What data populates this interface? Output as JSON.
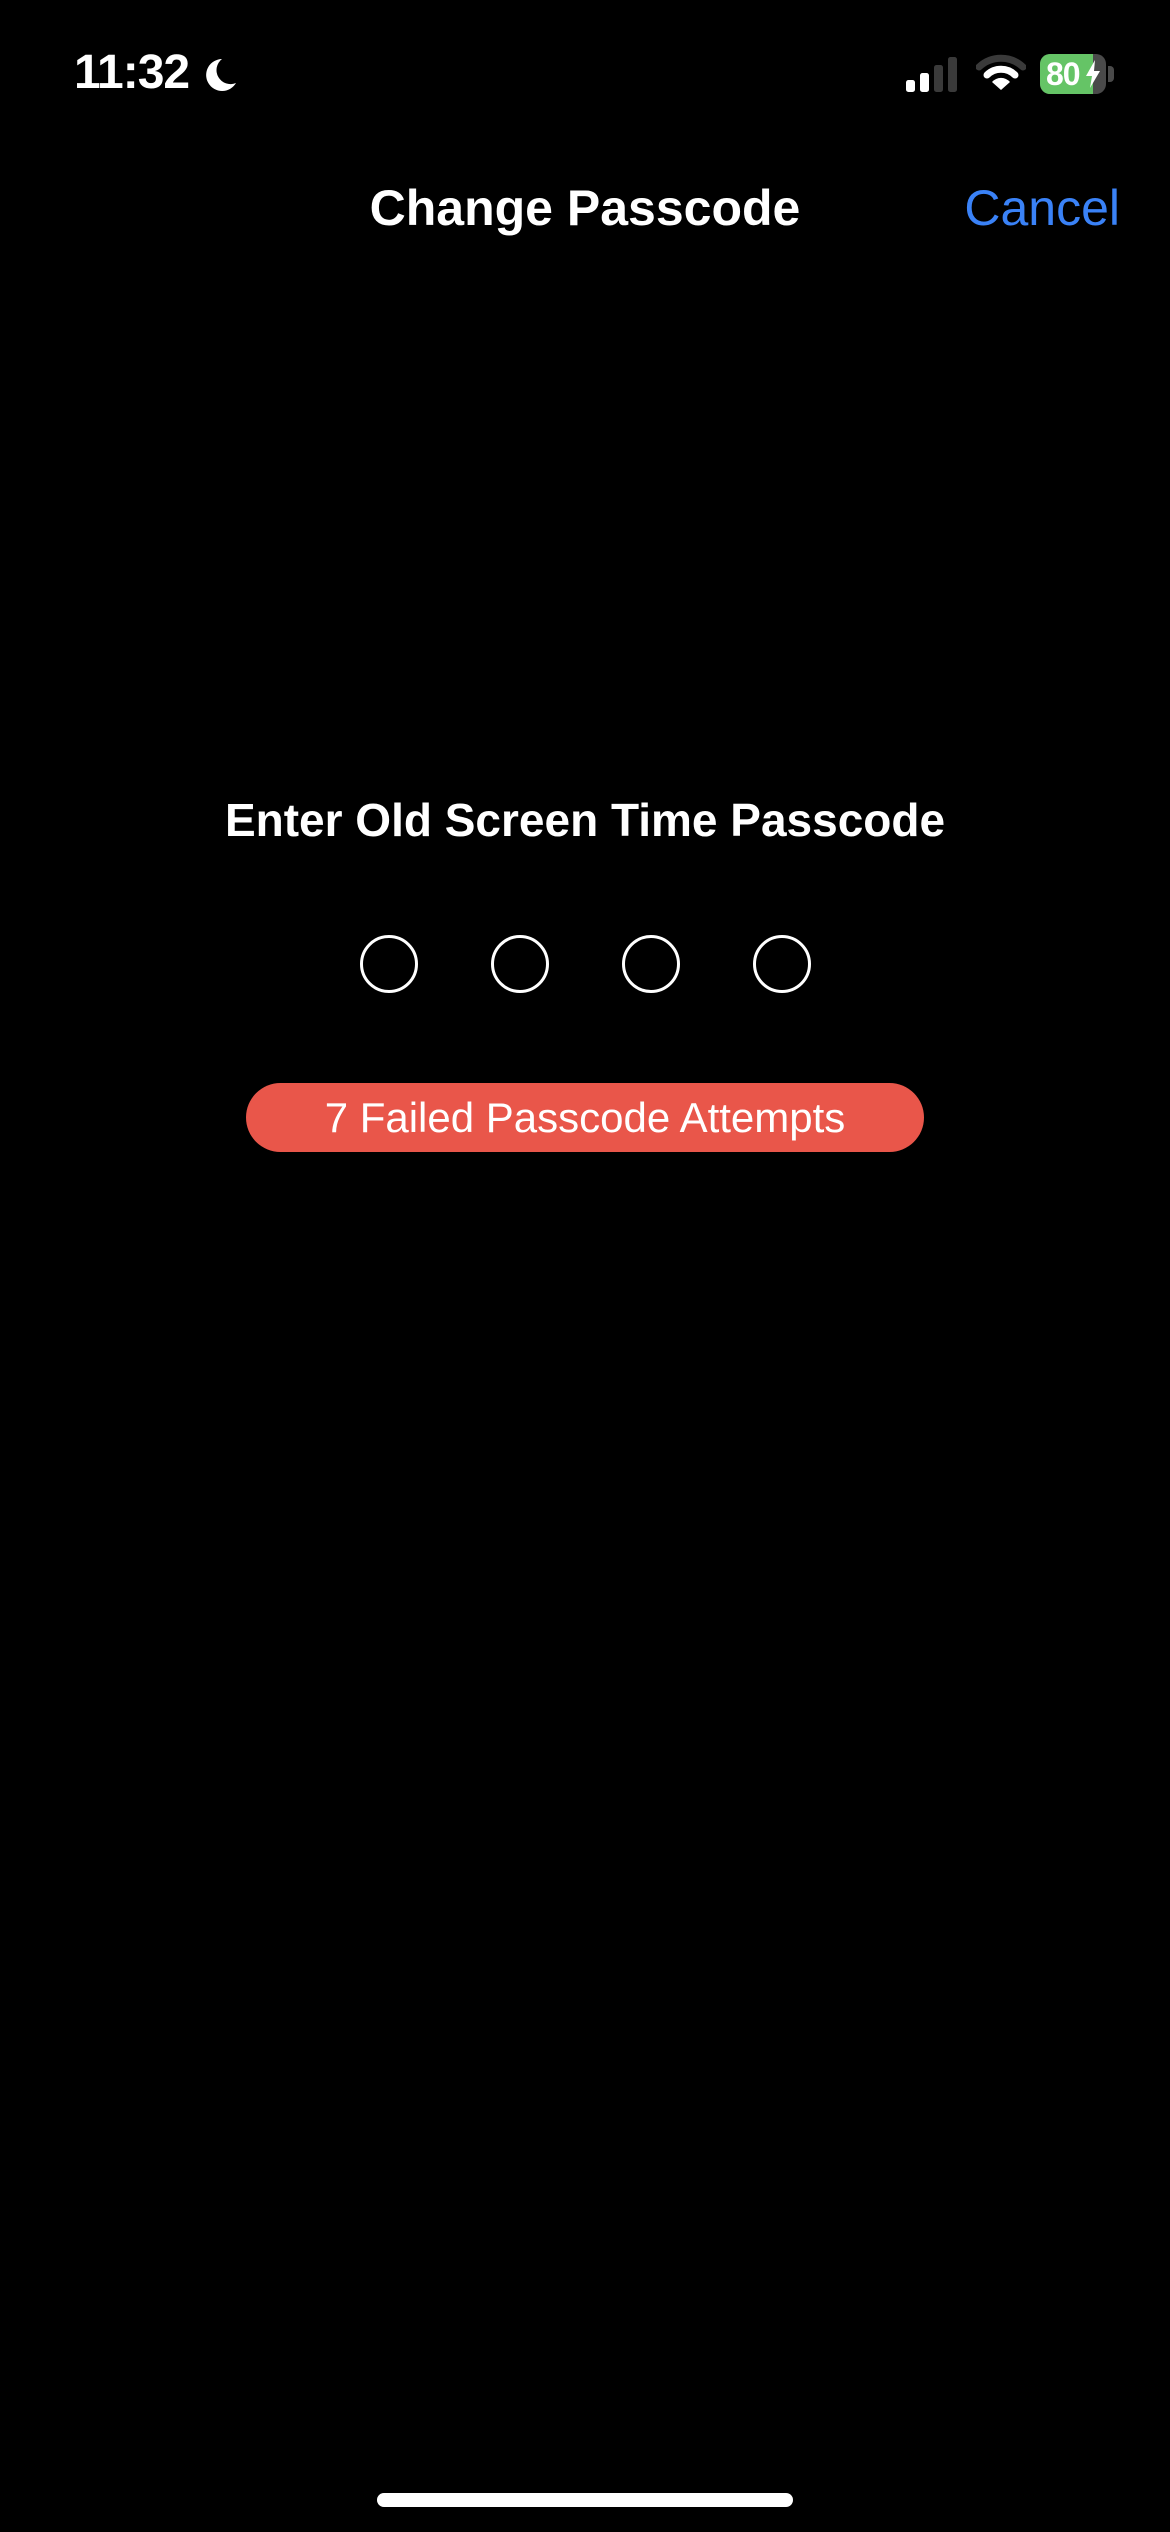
{
  "status_bar": {
    "time": "11:32",
    "focus_icon": "moon-icon",
    "signal_icon": "cellular-signal-icon",
    "signal_bars_active": 2,
    "signal_bars_total": 4,
    "wifi_icon": "wifi-icon",
    "battery_percent": "80",
    "battery_level": 0.8,
    "battery_charging": true,
    "battery_color": "#65C466"
  },
  "nav": {
    "title": "Change Passcode",
    "cancel_label": "Cancel",
    "accent_color": "#3A82F7"
  },
  "passcode": {
    "prompt": "Enter Old Screen Time Passcode",
    "digits_total": 4,
    "digits_entered": 0,
    "failed_attempts_label": "7 Failed Passcode Attempts",
    "failed_badge_color": "#E9564A"
  }
}
